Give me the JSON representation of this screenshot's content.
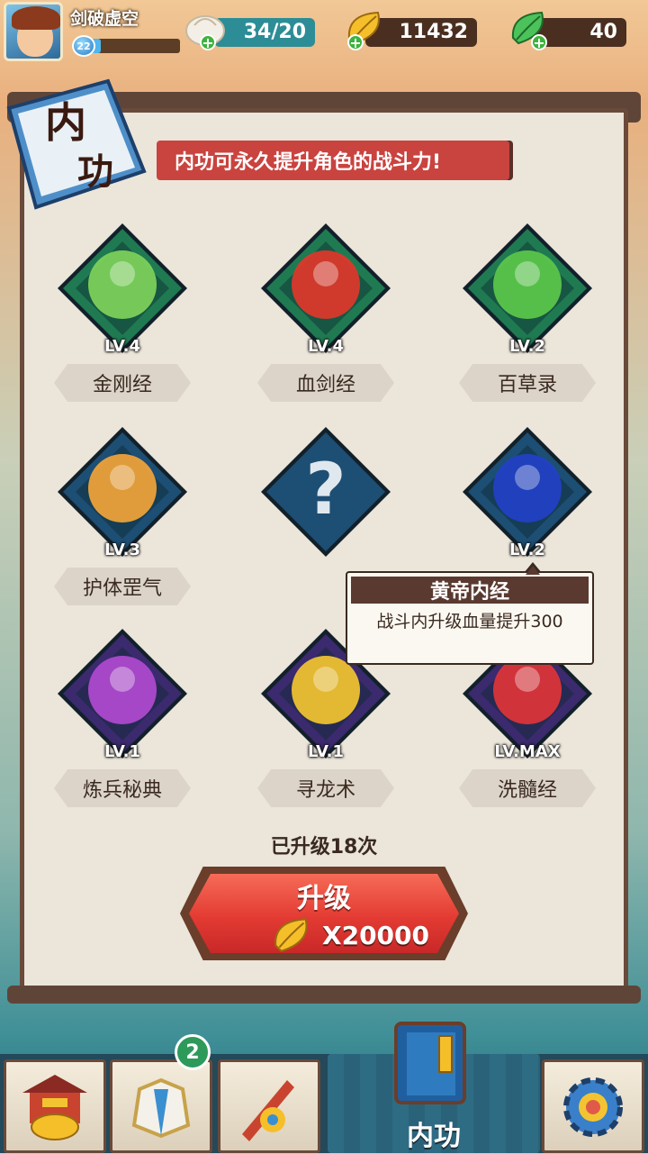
{
  "player": {
    "name": "剑破虚空",
    "level": "22",
    "xp_fraction": 0.12
  },
  "resources": {
    "stamina": {
      "icon": "bun-icon",
      "value": "34/20"
    },
    "gold": {
      "icon": "gold-leaf-icon",
      "value": "11432"
    },
    "jade": {
      "icon": "jade-leaf-icon",
      "value": "40"
    }
  },
  "panel": {
    "emblem_text": "内功",
    "banner": "内功可永久提升角色的战斗力!"
  },
  "skills": [
    {
      "name": "金刚经",
      "level": "LV.4",
      "icon": "strong-man-icon",
      "frame": "#1f7a52",
      "color": "#7fd25a"
    },
    {
      "name": "血剑经",
      "level": "LV.4",
      "icon": "blood-sword-icon",
      "frame": "#1f7a52",
      "color": "#e0372a"
    },
    {
      "name": "百草录",
      "level": "LV.2",
      "icon": "herb-leaf-icon",
      "frame": "#1f7a52",
      "color": "#5cc84a"
    },
    {
      "name": "护体罡气",
      "level": "LV.3",
      "icon": "golden-body-icon",
      "frame": "#1d4e74",
      "color": "#f2a43a"
    },
    {
      "name": "",
      "level": "",
      "icon": "locked-question-icon",
      "frame": "#1d4e74",
      "color": "#dfe8ee"
    },
    {
      "name": "黄帝内经",
      "level": "LV.2",
      "icon": "blue-spirit-icon",
      "frame": "#1d4e74",
      "color": "#2340c8"
    },
    {
      "name": "炼兵秘典",
      "level": "LV.1",
      "icon": "anvil-icon",
      "frame": "#3b2a6e",
      "color": "#b04ad0"
    },
    {
      "name": "寻龙术",
      "level": "LV.1",
      "icon": "gold-ingot-icon",
      "frame": "#3b2a6e",
      "color": "#f3c431"
    },
    {
      "name": "洗髓经",
      "level": "LV.MAX",
      "icon": "red-spirit-icon",
      "frame": "#3b2a6e",
      "color": "#e0343a"
    }
  ],
  "tooltip": {
    "title": "黄帝内经",
    "text": "战斗内升级血量提升300"
  },
  "upgrade": {
    "count_text": "已升级18次",
    "button_label": "升级",
    "cost": "X20000"
  },
  "nav": {
    "items": [
      {
        "name": "shop-icon"
      },
      {
        "name": "armor-icon",
        "badge": "2"
      },
      {
        "name": "weapon-icon"
      },
      {
        "name": "book-icon",
        "label": "内功"
      },
      {
        "name": "settings-gear-icon"
      }
    ]
  }
}
